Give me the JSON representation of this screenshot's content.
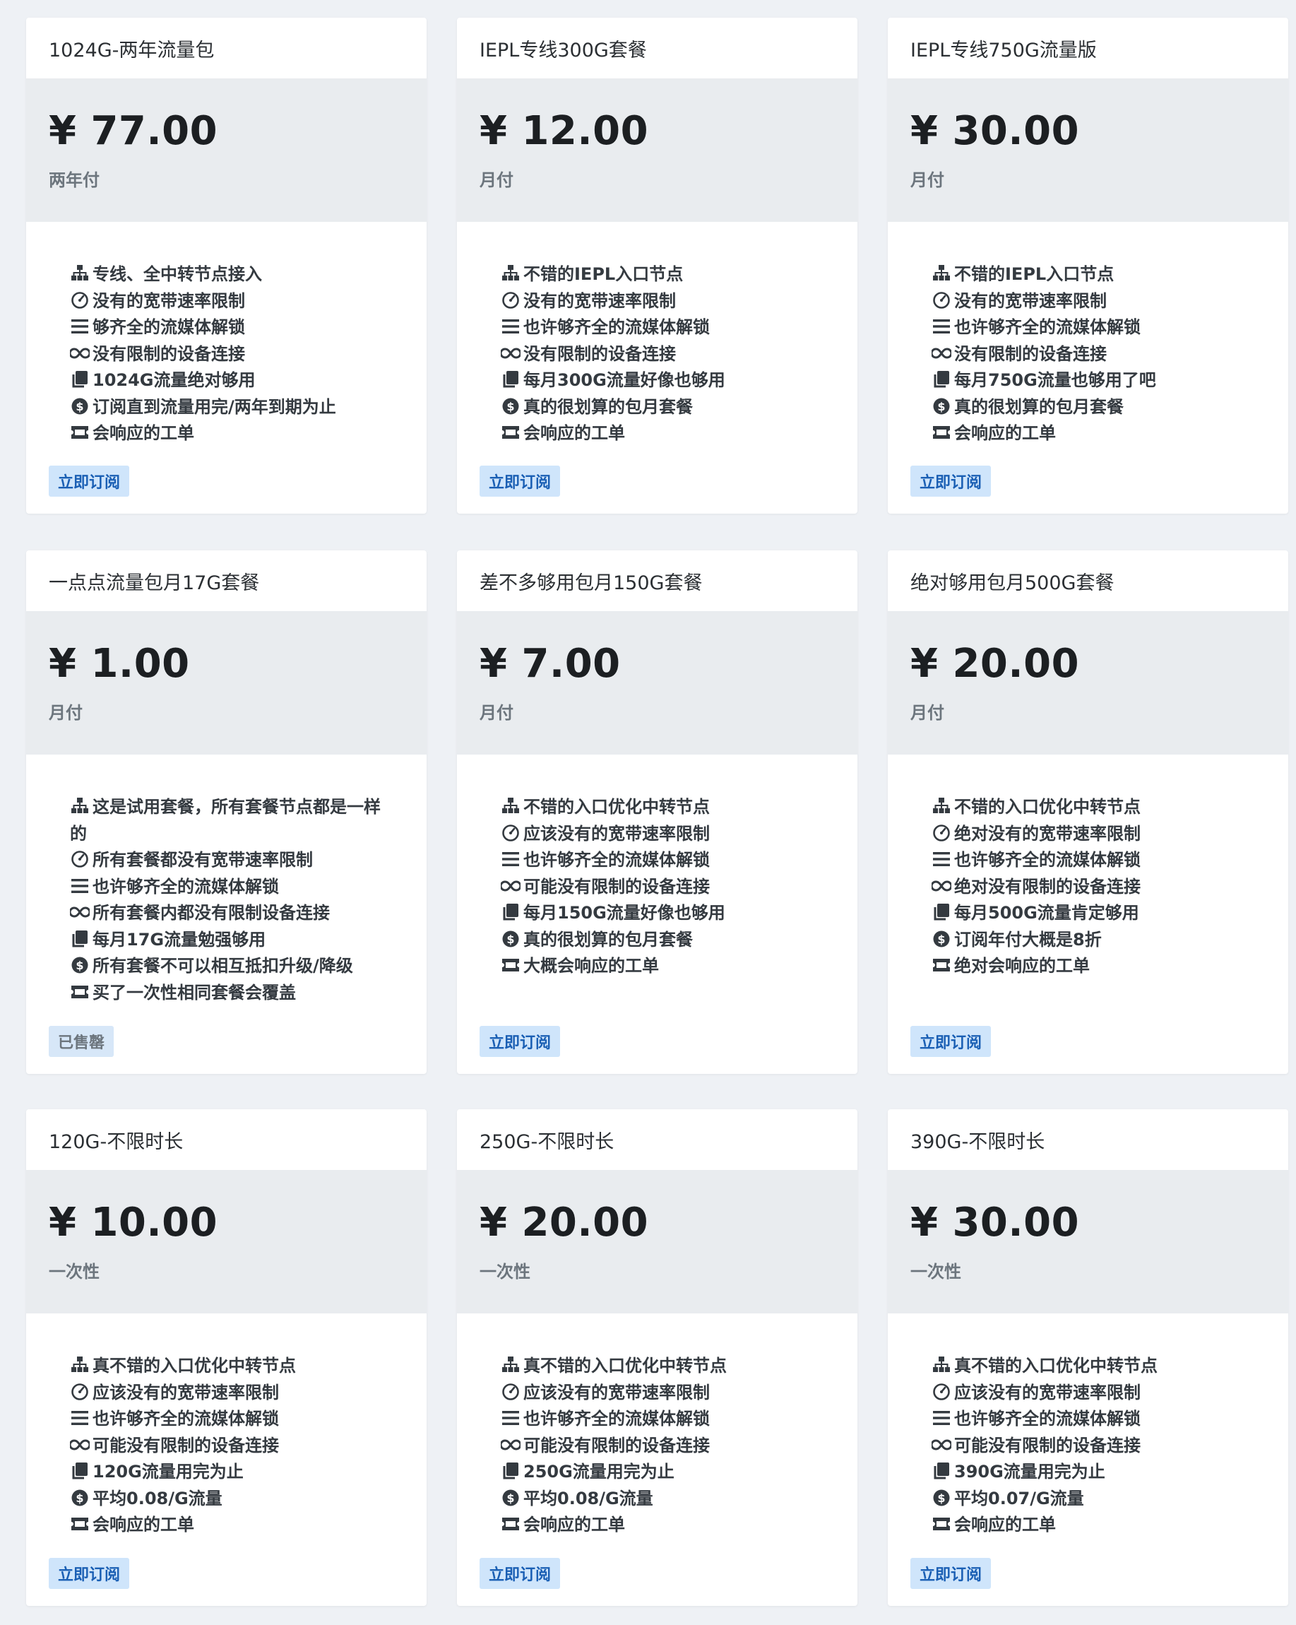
{
  "colors": {
    "page_background": "#eef1f5",
    "card_background": "#ffffff",
    "price_band": "#e9ecef",
    "button_bg": "#cfe5fb",
    "button_text": "#1a5fb4"
  },
  "feature_icons": [
    "sitemap-icon",
    "gauge-icon",
    "list-icon",
    "infinity-icon",
    "copy-icon",
    "dollar-icon",
    "ticket-icon"
  ],
  "plans": [
    {
      "title": "1024G-两年流量包",
      "price": "¥ 77.00",
      "period": "两年付",
      "features": [
        "专线、全中转节点接入",
        "没有的宽带速率限制",
        "够齐全的流媒体解锁",
        "没有限制的设备连接",
        "1024G流量绝对够用",
        "订阅直到流量用完/两年到期为止",
        "会响应的工单"
      ],
      "button": "立即订阅",
      "sold_out": false
    },
    {
      "title": "IEPL专线300G套餐",
      "price": "¥ 12.00",
      "period": "月付",
      "features": [
        "不错的IEPL入口节点",
        "没有的宽带速率限制",
        "也许够齐全的流媒体解锁",
        "没有限制的设备连接",
        "每月300G流量好像也够用",
        "真的很划算的包月套餐",
        "会响应的工单"
      ],
      "button": "立即订阅",
      "sold_out": false
    },
    {
      "title": "IEPL专线750G流量版",
      "price": "¥ 30.00",
      "period": "月付",
      "features": [
        "不错的IEPL入口节点",
        "没有的宽带速率限制",
        "也许够齐全的流媒体解锁",
        "没有限制的设备连接",
        "每月750G流量也够用了吧",
        "真的很划算的包月套餐",
        "会响应的工单"
      ],
      "button": "立即订阅",
      "sold_out": false
    },
    {
      "title": "一点点流量包月17G套餐",
      "price": "¥ 1.00",
      "period": "月付",
      "features": [
        "这是试用套餐，所有套餐节点都是一样的",
        "所有套餐都没有宽带速率限制",
        "也许够齐全的流媒体解锁",
        "所有套餐内都没有限制设备连接",
        "每月17G流量勉强够用",
        "所有套餐不可以相互抵扣升级/降级",
        "买了一次性相同套餐会覆盖"
      ],
      "button": "已售罄",
      "sold_out": true
    },
    {
      "title": "差不多够用包月150G套餐",
      "price": "¥ 7.00",
      "period": "月付",
      "features": [
        "不错的入口优化中转节点",
        "应该没有的宽带速率限制",
        "也许够齐全的流媒体解锁",
        "可能没有限制的设备连接",
        "每月150G流量好像也够用",
        "真的很划算的包月套餐",
        "大概会响应的工单"
      ],
      "button": "立即订阅",
      "sold_out": false
    },
    {
      "title": "绝对够用包月500G套餐",
      "price": "¥ 20.00",
      "period": "月付",
      "features": [
        "不错的入口优化中转节点",
        "绝对没有的宽带速率限制",
        "也许够齐全的流媒体解锁",
        "绝对没有限制的设备连接",
        "每月500G流量肯定够用",
        "订阅年付大概是8折",
        "绝对会响应的工单"
      ],
      "button": "立即订阅",
      "sold_out": false
    },
    {
      "title": "120G-不限时长",
      "price": "¥ 10.00",
      "period": "一次性",
      "features": [
        "真不错的入口优化中转节点",
        "应该没有的宽带速率限制",
        "也许够齐全的流媒体解锁",
        "可能没有限制的设备连接",
        "120G流量用完为止",
        "平均0.08/G流量",
        "会响应的工单"
      ],
      "button": "立即订阅",
      "sold_out": false
    },
    {
      "title": "250G-不限时长",
      "price": "¥ 20.00",
      "period": "一次性",
      "features": [
        "真不错的入口优化中转节点",
        "应该没有的宽带速率限制",
        "也许够齐全的流媒体解锁",
        "可能没有限制的设备连接",
        "250G流量用完为止",
        "平均0.08/G流量",
        "会响应的工单"
      ],
      "button": "立即订阅",
      "sold_out": false
    },
    {
      "title": "390G-不限时长",
      "price": "¥ 30.00",
      "period": "一次性",
      "features": [
        "真不错的入口优化中转节点",
        "应该没有的宽带速率限制",
        "也许够齐全的流媒体解锁",
        "可能没有限制的设备连接",
        "390G流量用完为止",
        "平均0.07/G流量",
        "会响应的工单"
      ],
      "button": "立即订阅",
      "sold_out": false
    }
  ]
}
